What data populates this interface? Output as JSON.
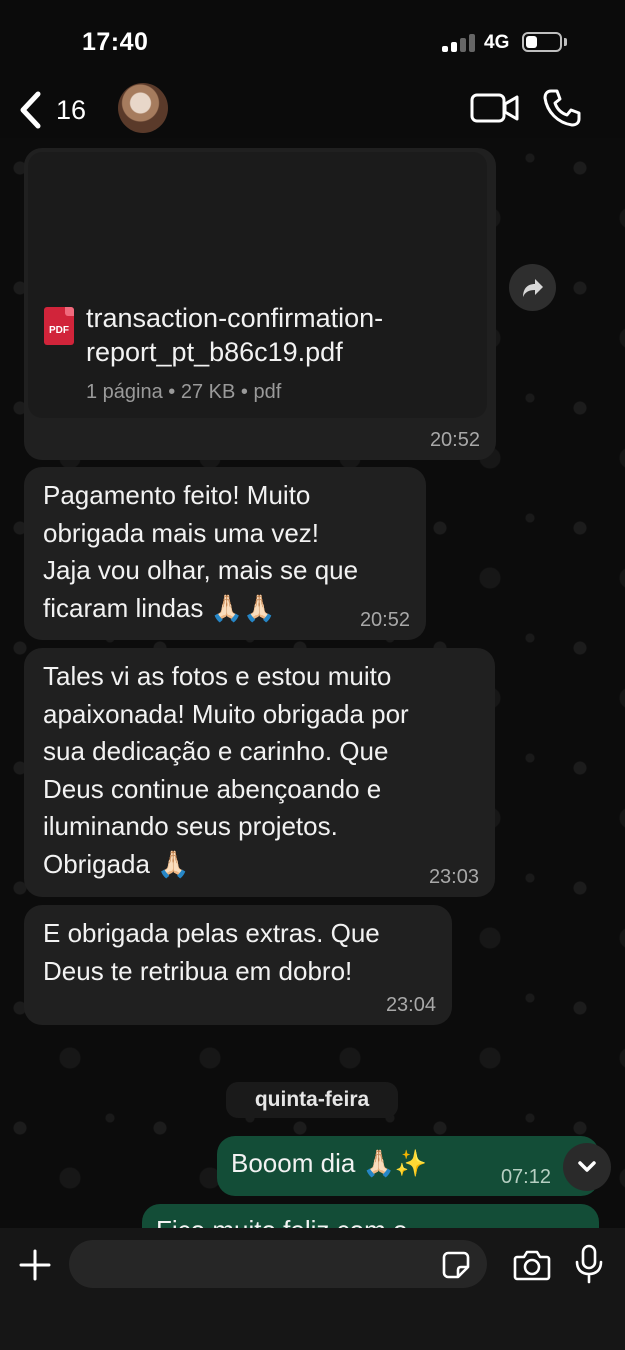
{
  "status_bar": {
    "time": "17:40",
    "network": "4G",
    "battery_level": 0.35
  },
  "header": {
    "back_count": "16",
    "icons": [
      "back-chevron-icon",
      "video-call-icon",
      "phone-icon"
    ]
  },
  "messages": [
    {
      "type": "document",
      "file_name": "transaction-confirmation-\nreport_pt_b86c19.pdf",
      "file_icon_label": "PDF",
      "meta": "1 página • 27 KB • pdf",
      "time": "20:52"
    },
    {
      "type": "text",
      "text": "Pagamento feito! Muito\nobrigada mais uma vez!\nJaja vou olhar, mais se que\nficaram lindas 🙏🏻🙏🏻",
      "time": "20:52"
    },
    {
      "type": "text",
      "text": "Tales vi as fotos e estou muito\napaixonada! Muito obrigada por\nsua dedicação e carinho. Que\nDeus continue abençoando e\niluminando seus projetos.\nObrigada 🙏🏻",
      "time": "23:03"
    },
    {
      "type": "text",
      "text": "E obrigada pelas extras. Que\nDeus te retribua em dobro!",
      "time": "23:04"
    }
  ],
  "date_separator": "quinta-feira",
  "outgoing": [
    {
      "text": "Booom dia 🙏🏻✨",
      "time": "07:12"
    },
    {
      "text": "Fico muito feliz com o"
    }
  ],
  "input_bar": {
    "placeholder": "",
    "icons": [
      "plus-icon",
      "sticker-icon",
      "camera-icon",
      "microphone-icon"
    ]
  },
  "colors": {
    "incoming_bubble": "#202020",
    "outgoing_bubble": "#134d37",
    "accent": "#25d366"
  }
}
